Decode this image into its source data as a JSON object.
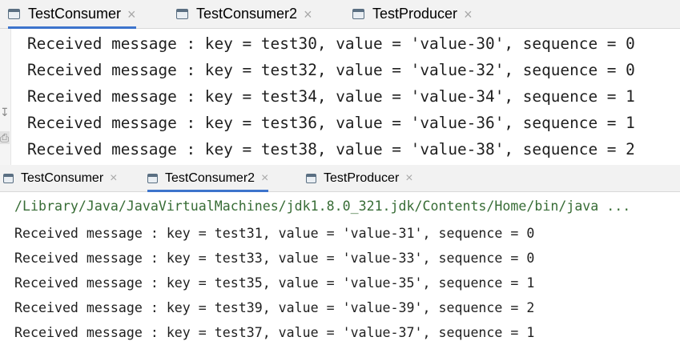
{
  "top_panel": {
    "tabs": [
      {
        "label": "TestConsumer",
        "active": true
      },
      {
        "label": "TestConsumer2",
        "active": false
      },
      {
        "label": "TestProducer",
        "active": false
      }
    ],
    "lines": [
      "Received message : key = test30, value = 'value-30', sequence = 0",
      "Received message : key = test32, value = 'value-32', sequence = 0",
      "Received message : key = test34, value = 'value-34', sequence = 1",
      "Received message : key = test36, value = 'value-36', sequence = 1",
      "Received message : key = test38, value = 'value-38', sequence = 2"
    ]
  },
  "bottom_panel": {
    "tabs": [
      {
        "label": "TestConsumer",
        "active": false
      },
      {
        "label": "TestConsumer2",
        "active": true
      },
      {
        "label": "TestProducer",
        "active": false
      }
    ],
    "command": "/Library/Java/JavaVirtualMachines/jdk1.8.0_321.jdk/Contents/Home/bin/java ...",
    "lines": [
      "Received message : key = test31, value = 'value-31', sequence = 0",
      "Received message : key = test33, value = 'value-33', sequence = 0",
      "Received message : key = test35, value = 'value-35', sequence = 1",
      "Received message : key = test39, value = 'value-39', sequence = 2",
      "Received message : key = test37, value = 'value-37', sequence = 1"
    ]
  },
  "close_glyph": "×",
  "colors": {
    "active_tab_underline": "#3d74cc",
    "command_text": "#376c35",
    "console_text": "#1f1f1f"
  },
  "icons": {
    "tab": "file-tab-icon",
    "close": "close-icon"
  }
}
